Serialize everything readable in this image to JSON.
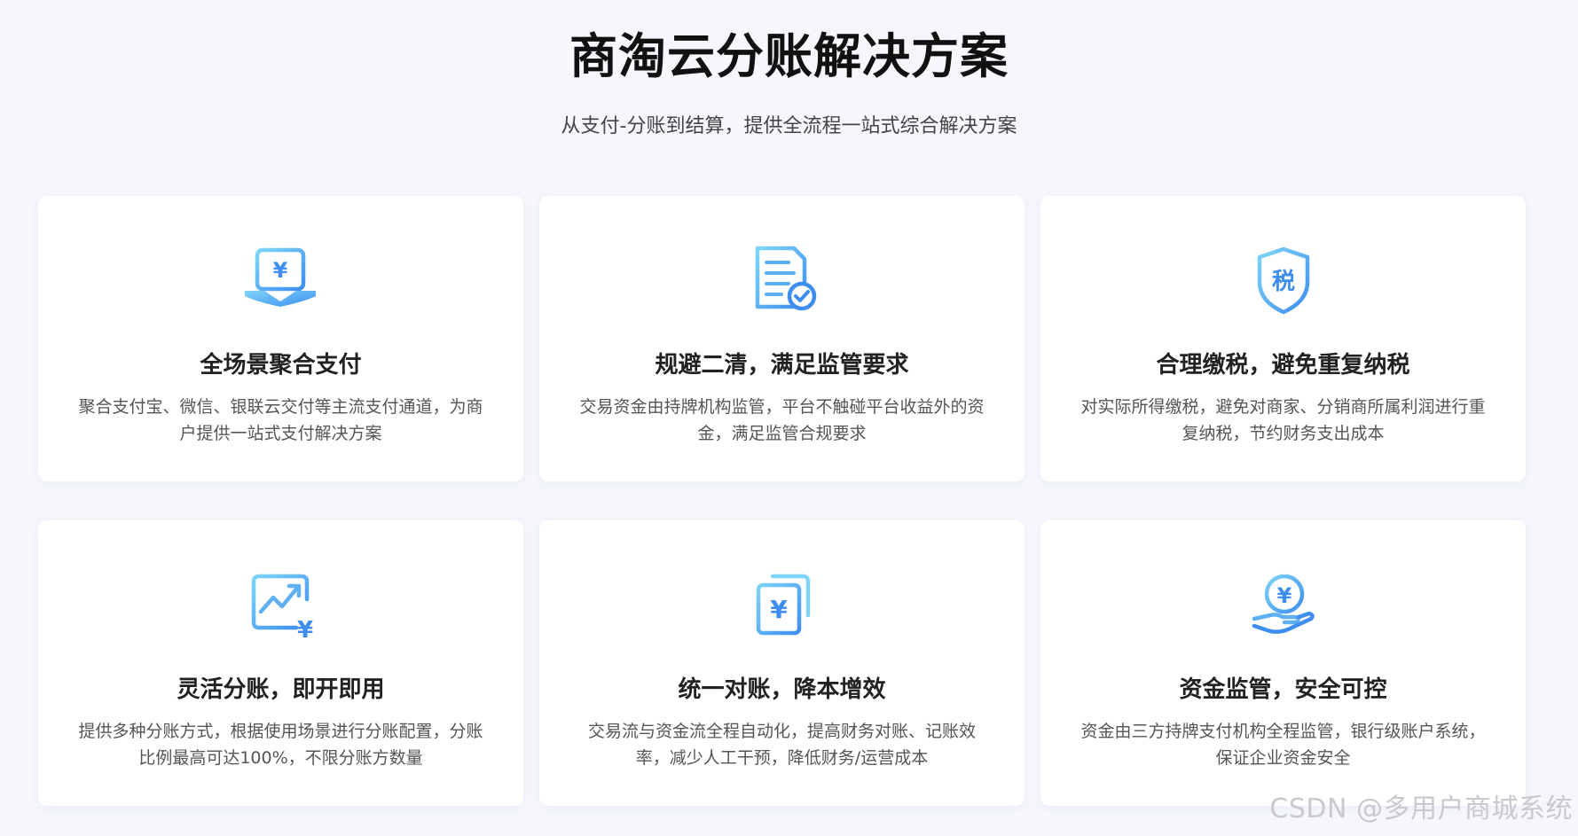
{
  "header": {
    "title": "商淘云分账解决方案",
    "subtitle": "从支付-分账到结算，提供全流程一站式综合解决方案"
  },
  "cards": [
    {
      "icon": "payment-scene-icon",
      "title": "全场景聚合支付",
      "desc": "聚合支付宝、微信、银联云交付等主流支付通道，为商户提供一站式支付解决方案"
    },
    {
      "icon": "compliance-document-icon",
      "title": "规避二清，满足监管要求",
      "desc": "交易资金由持牌机构监管，平台不触碰平台收益外的资金，满足监管合规要求"
    },
    {
      "icon": "tax-shield-icon",
      "title": "合理缴税，避免重复纳税",
      "desc": "对实际所得缴税，避免对商家、分销商所属利润进行重复纳税，节约财务支出成本"
    },
    {
      "icon": "growth-chart-icon",
      "title": "灵活分账，即开即用",
      "desc": "提供多种分账方式，根据使用场景进行分账配置，分账比例最高可达100%，不限分账方数量"
    },
    {
      "icon": "reconciliation-cards-icon",
      "title": "统一对账，降本增效",
      "desc": "交易流与资金流全程自动化，提高财务对账、记账效率，减少人工干预，降低财务/运营成本"
    },
    {
      "icon": "fund-hand-icon",
      "title": "资金监管，安全可控",
      "desc": "资金由三方持牌支付机构全程监管，银行级账户系统，保证企业资金安全"
    }
  ],
  "icon_glyphs": {
    "yuan": "¥",
    "tax": "税"
  },
  "colors": {
    "icon_light": "#7fd4f7",
    "icon_dark": "#3d8ef0"
  },
  "watermark": "CSDN @多用户商城系统"
}
